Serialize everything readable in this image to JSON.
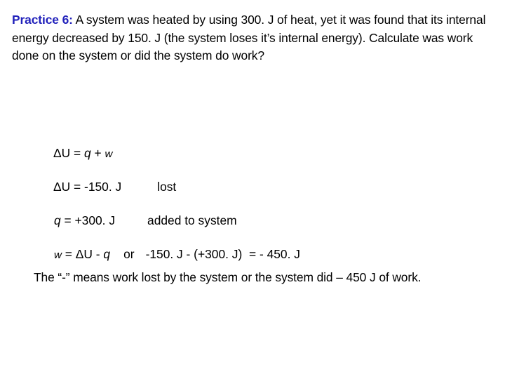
{
  "slide": {
    "background_color": "#ffffff",
    "text_color": "#000000",
    "accent_color": "#2222BB"
  },
  "problem": {
    "label": "Practice 6:",
    "statement": " A system was heated by using 300. J of heat, yet it was found that its internal energy decreased by 150. J (the system loses it’s internal energy). Calculate was work done on the system or did the system do work?"
  },
  "solution": {
    "lines": [
      {
        "id": "general-equation",
        "lhs": "ΔU = ",
        "var1": "q",
        "operator": " + ",
        "var2": "w",
        "tail": "",
        "note": ""
      },
      {
        "id": "delta-u-value",
        "lhs": "ΔU = -150. J",
        "note": "lost"
      },
      {
        "id": "q-value",
        "var1": "q",
        "lhs": " = +300. J",
        "note": "added to system"
      },
      {
        "id": "work-equation",
        "var2": "w",
        "lhs": " = ΔU - ",
        "var1": "q",
        "connector": "or",
        "tail": "-150. J - (+300. J)  = - 450. J"
      }
    ]
  },
  "closing": {
    "text": "The “-” means work lost by the system or the system did – 450 J of work."
  }
}
